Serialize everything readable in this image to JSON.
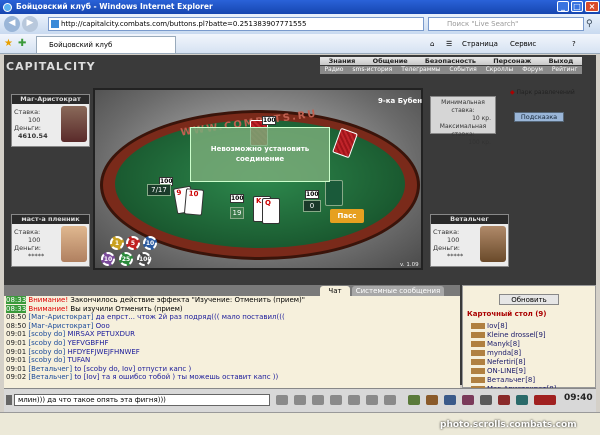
{
  "window": {
    "title": "Бойцовский клуб - Windows Internet Explorer"
  },
  "address": {
    "url": "http://capitalcity.combats.com/buttons.pl?batte=0.251383907771555",
    "search_placeholder": "Поиск \"Live Search\""
  },
  "tabs": [
    {
      "label": "Бойцовский клуб"
    }
  ],
  "toolbar": {
    "page": "Страница",
    "service": "Сервис"
  },
  "game": {
    "logo": "CAPITALCITY",
    "menu_top": [
      "Знания",
      "Общение",
      "Безопасность",
      "Персонаж",
      "Выход"
    ],
    "menu_sub": [
      "Радио",
      "sms-история",
      "Телеграммы",
      "События",
      "Скроллы",
      "Форум",
      "Рейтинг"
    ],
    "players": [
      {
        "name": "Маг-Аристократ",
        "bet_label": "Ставка:",
        "bet": "100",
        "money_label": "Деньги:",
        "money": "4610.54"
      },
      {
        "name": "маст-а пленник",
        "bet_label": "Ставка:",
        "bet": "100",
        "money_label": "Деньги:",
        "money": "*****"
      },
      {
        "name": "Ветальчег",
        "bet_label": "Ставка:",
        "bet": "100",
        "money_label": "Деньги:",
        "money": "*****"
      }
    ],
    "table_title": "9-ка Бубен",
    "felt_text": "WWW.COMBATS.RU",
    "min_bet_label": "Минимальная ставка:",
    "min_bet": "10 кр.",
    "max_bet_label": "Максимальная ставка:",
    "max_bet": "100 кр.",
    "park_link": "Парк развлечений",
    "hint_button": "Подсказка",
    "modal_text": "Невозможно установить соединение",
    "score_left": "7/17",
    "bet_badges": [
      "100",
      "100",
      "100",
      "100"
    ],
    "pot": "19",
    "counter": "0",
    "pass_button": "Пасс",
    "chips": [
      "1",
      "5",
      "10",
      "25",
      "100",
      "10"
    ],
    "version": "v. 1.09"
  },
  "chat": {
    "tabs": [
      "Чат",
      "Системные сообщения"
    ],
    "lines": [
      {
        "time": "08:33",
        "hl": true,
        "parts": [
          {
            "c": "warn",
            "t": "Внимание! "
          },
          {
            "c": "txt",
            "t": "Закончилось действие эффекта \"Изучение: Отменить (прием)\""
          }
        ]
      },
      {
        "time": "08:33",
        "hl": true,
        "parts": [
          {
            "c": "warn",
            "t": "Внимание! "
          },
          {
            "c": "txt",
            "t": "Вы изучили Отменить (прием)"
          }
        ]
      },
      {
        "time": "08:50",
        "hl": false,
        "parts": [
          {
            "c": "nick",
            "t": "[Маг-Аристократ] "
          },
          {
            "c": "msg",
            "t": "да епрст... чтож 2й раз подряд((( мало поставил((("
          }
        ]
      },
      {
        "time": "08:50",
        "hl": false,
        "parts": [
          {
            "c": "nick",
            "t": "[Маг-Аристократ] "
          },
          {
            "c": "msg",
            "t": "Ооо"
          }
        ]
      },
      {
        "time": "09:01",
        "hl": false,
        "parts": [
          {
            "c": "nick",
            "t": "[scoby do] "
          },
          {
            "c": "msg",
            "t": "MIRSAX PETUXDUR"
          }
        ]
      },
      {
        "time": "09:01",
        "hl": false,
        "parts": [
          {
            "c": "nick",
            "t": "[scoby do] "
          },
          {
            "c": "msg",
            "t": "YEFVGBFHF"
          }
        ]
      },
      {
        "time": "09:01",
        "hl": false,
        "parts": [
          {
            "c": "nick",
            "t": "[scoby do] "
          },
          {
            "c": "msg",
            "t": "HFDYEFJWEJFHNWEF"
          }
        ]
      },
      {
        "time": "09:01",
        "hl": false,
        "parts": [
          {
            "c": "nick",
            "t": "[scoby do] "
          },
          {
            "c": "msg",
            "t": "TUFAN"
          }
        ]
      },
      {
        "time": "09:01",
        "hl": false,
        "parts": [
          {
            "c": "nick",
            "t": "[Ветальчег] "
          },
          {
            "c": "msg",
            "t": "to [scoby do, Iov] отпусти капс )"
          }
        ]
      },
      {
        "time": "09:02",
        "hl": false,
        "parts": [
          {
            "c": "nick",
            "t": "[Ветальчег] "
          },
          {
            "c": "msg",
            "t": "to [Iov] та я ошибсо тобой ) ты можешь оставит капс ))"
          }
        ]
      }
    ],
    "input_value": "млин))) да что такое опять эта фигня)))"
  },
  "room": {
    "refresh_button": "Обновить",
    "title": "Карточный стол (9)",
    "users": [
      "Iov[8]",
      "Kleine drossel[9]",
      "Manyk[8]",
      "mynda[8]",
      "Nefertiri[8]",
      "ON-LINE[9]",
      "Ветальчег[8]",
      "Маг-Аристократ[8]"
    ]
  },
  "clock": "09:40",
  "watermark": "photo.scrolls.combats.com"
}
